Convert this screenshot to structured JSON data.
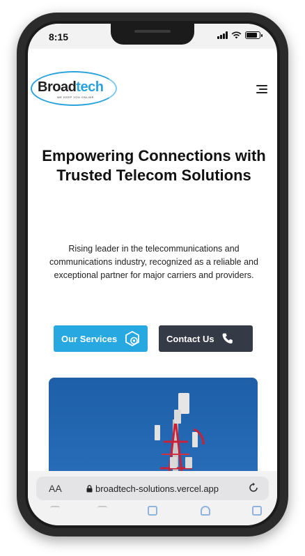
{
  "status": {
    "time": "8:15",
    "battery_level": 0.85
  },
  "brand": {
    "logo_main": "Broad",
    "logo_accent": "tech",
    "tagline": "WE KEEP YOU ONLINE",
    "logo_color": "#2aa3dc"
  },
  "header": {
    "menu_icon": "hamburger-menu-icon"
  },
  "hero": {
    "title": "Empowering Connections with Trusted Telecom Solutions",
    "description": "Rising leader in the telecommunications and communications industry, recognized as a reliable and exceptional partner for major carriers and providers."
  },
  "buttons": {
    "services_label": "Our Services",
    "services_icon": "gear-hexagon-icon",
    "contact_label": "Contact Us",
    "contact_icon": "phone-icon",
    "services_color": "#28a8e0",
    "contact_color": "#343a46"
  },
  "image": {
    "subject": "cell-tower-image"
  },
  "browser": {
    "text_size_label": "AA",
    "url": "broadtech-solutions.vercel.app",
    "lock_icon": "lock-icon",
    "reload_icon": "reload-icon"
  }
}
